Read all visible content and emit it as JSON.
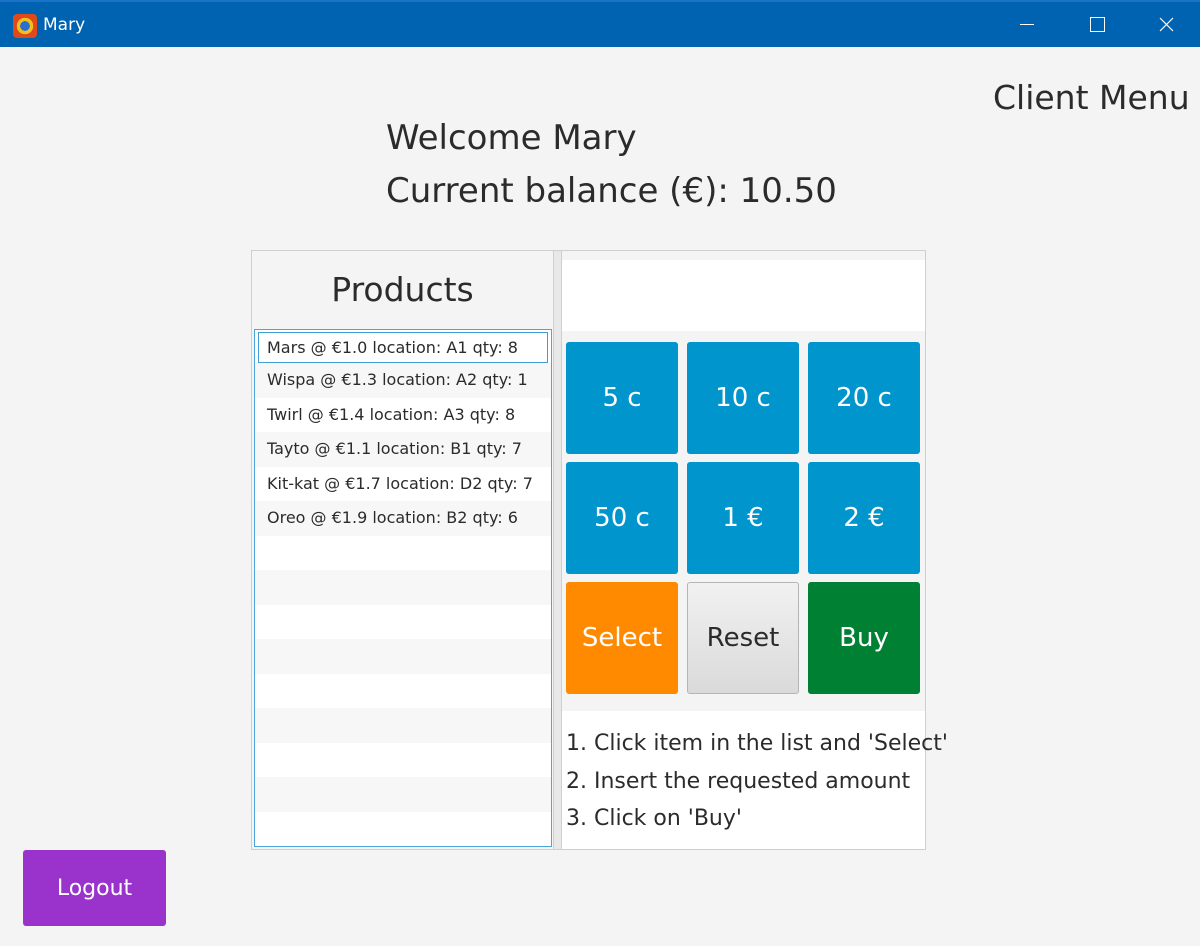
{
  "window": {
    "title": "Mary"
  },
  "header": {
    "menu_title": "Client Menu"
  },
  "welcome": {
    "text": "Welcome Mary",
    "balance": "Current balance (€): 10.50"
  },
  "products": {
    "title": "Products",
    "items": [
      "Mars @ €1.0 location: A1 qty: 8",
      "Wispa @ €1.3 location: A2 qty: 1",
      "Twirl @ €1.4 location: A3 qty: 8",
      "Tayto @ €1.1 location: B1 qty: 7",
      "Kit-kat @ €1.7 location: D2 qty: 7",
      "Oreo @ €1.9 location: B2 qty: 6"
    ]
  },
  "coins": [
    "5 c",
    "10 c",
    "20 c",
    "50 c",
    "1 €",
    "2 €"
  ],
  "actions": {
    "select": "Select",
    "reset": "Reset",
    "buy": "Buy"
  },
  "instructions": [
    "1. Click item in the list and 'Select'",
    "2. Insert the requested amount",
    "3. Click on 'Buy'"
  ],
  "logout": "Logout",
  "colors": {
    "titlebar": "#0063b1",
    "coin": "#0095cc",
    "select": "#ff8a00",
    "buy": "#008033",
    "logout": "#9933cc"
  }
}
